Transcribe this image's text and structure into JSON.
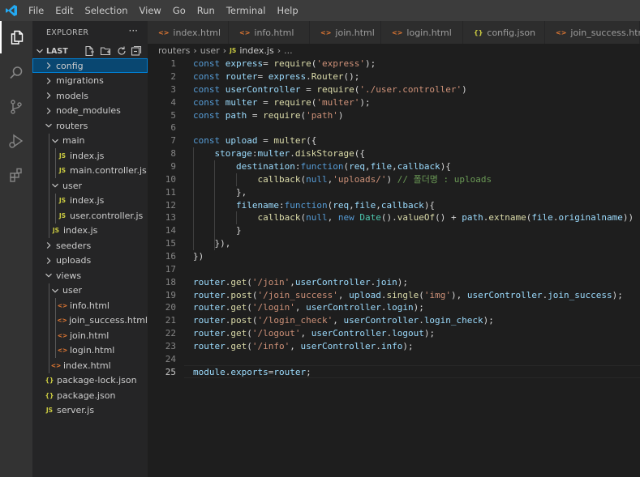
{
  "menu": [
    "File",
    "Edit",
    "Selection",
    "View",
    "Go",
    "Run",
    "Terminal",
    "Help"
  ],
  "explorer": {
    "title": "EXPLORER",
    "more": "···",
    "root": "LAST",
    "tree": [
      {
        "label": "config",
        "type": "folder",
        "open": false,
        "depth": 0,
        "selected": true
      },
      {
        "label": "migrations",
        "type": "folder",
        "open": false,
        "depth": 0
      },
      {
        "label": "models",
        "type": "folder",
        "open": false,
        "depth": 0
      },
      {
        "label": "node_modules",
        "type": "folder",
        "open": false,
        "depth": 0
      },
      {
        "label": "routers",
        "type": "folder",
        "open": true,
        "depth": 0
      },
      {
        "label": "main",
        "type": "folder",
        "open": true,
        "depth": 1
      },
      {
        "label": "index.js",
        "type": "js",
        "depth": 2
      },
      {
        "label": "main.controller.js",
        "type": "js",
        "depth": 2
      },
      {
        "label": "user",
        "type": "folder",
        "open": true,
        "depth": 1
      },
      {
        "label": "index.js",
        "type": "js",
        "depth": 2
      },
      {
        "label": "user.controller.js",
        "type": "js",
        "depth": 2
      },
      {
        "label": "index.js",
        "type": "js",
        "depth": 1
      },
      {
        "label": "seeders",
        "type": "folder",
        "open": false,
        "depth": 0
      },
      {
        "label": "uploads",
        "type": "folder",
        "open": false,
        "depth": 0
      },
      {
        "label": "views",
        "type": "folder",
        "open": true,
        "depth": 0
      },
      {
        "label": "user",
        "type": "folder",
        "open": true,
        "depth": 1
      },
      {
        "label": "info.html",
        "type": "html",
        "depth": 2
      },
      {
        "label": "join_success.html",
        "type": "html",
        "depth": 2
      },
      {
        "label": "join.html",
        "type": "html",
        "depth": 2
      },
      {
        "label": "login.html",
        "type": "html",
        "depth": 2
      },
      {
        "label": "index.html",
        "type": "html",
        "depth": 1
      },
      {
        "label": "package-lock.json",
        "type": "json",
        "depth": 0
      },
      {
        "label": "package.json",
        "type": "json",
        "depth": 0
      },
      {
        "label": "server.js",
        "type": "js",
        "depth": 0
      }
    ]
  },
  "tabs": [
    {
      "label": "index.html",
      "type": "html"
    },
    {
      "label": "info.html",
      "type": "html"
    },
    {
      "label": "join.html",
      "type": "html"
    },
    {
      "label": "login.html",
      "type": "html"
    },
    {
      "label": "config.json",
      "type": "json"
    },
    {
      "label": "join_success.html",
      "type": "html"
    }
  ],
  "breadcrumb": {
    "parts": [
      "routers",
      "user"
    ],
    "file": "index.js",
    "tail": "..."
  },
  "editor": {
    "current_line": 25,
    "lines": [
      [
        [
          "kw",
          "const "
        ],
        [
          "var",
          "express"
        ],
        [
          "",
          "= "
        ],
        [
          "fn",
          "require"
        ],
        [
          "",
          "("
        ],
        [
          "str",
          "'express'"
        ],
        [
          "",
          ");"
        ]
      ],
      [
        [
          "kw",
          "const "
        ],
        [
          "var",
          "router"
        ],
        [
          "",
          "= "
        ],
        [
          "var",
          "express"
        ],
        [
          "",
          "."
        ],
        [
          "fn",
          "Router"
        ],
        [
          "",
          "();"
        ]
      ],
      [
        [
          "kw",
          "const "
        ],
        [
          "var",
          "userController"
        ],
        [
          "",
          " = "
        ],
        [
          "fn",
          "require"
        ],
        [
          "",
          "("
        ],
        [
          "str",
          "'./user.controller'"
        ],
        [
          "",
          ")"
        ]
      ],
      [
        [
          "kw",
          "const "
        ],
        [
          "var",
          "multer"
        ],
        [
          "",
          " = "
        ],
        [
          "fn",
          "require"
        ],
        [
          "",
          "("
        ],
        [
          "str",
          "'multer'"
        ],
        [
          "",
          ");"
        ]
      ],
      [
        [
          "kw",
          "const "
        ],
        [
          "var",
          "path"
        ],
        [
          "",
          " = "
        ],
        [
          "fn",
          "require"
        ],
        [
          "",
          "("
        ],
        [
          "str",
          "'path'"
        ],
        [
          "",
          ")"
        ]
      ],
      [],
      [
        [
          "kw",
          "const "
        ],
        [
          "var",
          "upload"
        ],
        [
          "",
          " = "
        ],
        [
          "fn",
          "multer"
        ],
        [
          "",
          "({"
        ]
      ],
      [
        [
          "",
          "    "
        ],
        [
          "var",
          "storage"
        ],
        [
          "",
          ":"
        ],
        [
          "var",
          "multer"
        ],
        [
          "",
          "."
        ],
        [
          "fn",
          "diskStorage"
        ],
        [
          "",
          "({"
        ]
      ],
      [
        [
          "",
          "        "
        ],
        [
          "var",
          "destination"
        ],
        [
          "",
          ":"
        ],
        [
          "kw",
          "function"
        ],
        [
          "",
          "("
        ],
        [
          "var",
          "req"
        ],
        [
          "",
          ","
        ],
        [
          "var",
          "file"
        ],
        [
          "",
          ","
        ],
        [
          "var",
          "callback"
        ],
        [
          "",
          "){"
        ]
      ],
      [
        [
          "",
          "            "
        ],
        [
          "fn",
          "callback"
        ],
        [
          "",
          "("
        ],
        [
          "kw",
          "null"
        ],
        [
          "",
          ","
        ],
        [
          "str",
          "'uploads/'"
        ],
        [
          "",
          ") "
        ],
        [
          "cmt",
          "// 폴더명 : uploads"
        ]
      ],
      [
        [
          "",
          "        },"
        ]
      ],
      [
        [
          "",
          "        "
        ],
        [
          "var",
          "filename"
        ],
        [
          "",
          ":"
        ],
        [
          "kw",
          "function"
        ],
        [
          "",
          "("
        ],
        [
          "var",
          "req"
        ],
        [
          "",
          ","
        ],
        [
          "var",
          "file"
        ],
        [
          "",
          ","
        ],
        [
          "var",
          "callback"
        ],
        [
          "",
          "){"
        ]
      ],
      [
        [
          "",
          "            "
        ],
        [
          "fn",
          "callback"
        ],
        [
          "",
          "("
        ],
        [
          "kw",
          "null"
        ],
        [
          "",
          ", "
        ],
        [
          "kw",
          "new "
        ],
        [
          "cls",
          "Date"
        ],
        [
          "",
          "()."
        ],
        [
          "fn",
          "valueOf"
        ],
        [
          "",
          "() + "
        ],
        [
          "var",
          "path"
        ],
        [
          "",
          "."
        ],
        [
          "fn",
          "extname"
        ],
        [
          "",
          "("
        ],
        [
          "var",
          "file"
        ],
        [
          "",
          "."
        ],
        [
          "var",
          "originalname"
        ],
        [
          "",
          "))"
        ]
      ],
      [
        [
          "",
          "        }"
        ]
      ],
      [
        [
          "",
          "    }),"
        ]
      ],
      [
        [
          "",
          "})"
        ]
      ],
      [],
      [
        [
          "var",
          "router"
        ],
        [
          "",
          "."
        ],
        [
          "fn",
          "get"
        ],
        [
          "",
          "("
        ],
        [
          "str",
          "'/join'"
        ],
        [
          "",
          ","
        ],
        [
          "var",
          "userController"
        ],
        [
          "",
          "."
        ],
        [
          "var",
          "join"
        ],
        [
          "",
          ");"
        ]
      ],
      [
        [
          "var",
          "router"
        ],
        [
          "",
          "."
        ],
        [
          "fn",
          "post"
        ],
        [
          "",
          "("
        ],
        [
          "str",
          "'/join_success'"
        ],
        [
          "",
          ", "
        ],
        [
          "var",
          "upload"
        ],
        [
          "",
          "."
        ],
        [
          "fn",
          "single"
        ],
        [
          "",
          "("
        ],
        [
          "str",
          "'img'"
        ],
        [
          "",
          "), "
        ],
        [
          "var",
          "userController"
        ],
        [
          "",
          "."
        ],
        [
          "var",
          "join_success"
        ],
        [
          "",
          ");"
        ]
      ],
      [
        [
          "var",
          "router"
        ],
        [
          "",
          "."
        ],
        [
          "fn",
          "get"
        ],
        [
          "",
          "("
        ],
        [
          "str",
          "'/login'"
        ],
        [
          "",
          ", "
        ],
        [
          "var",
          "userController"
        ],
        [
          "",
          "."
        ],
        [
          "var",
          "login"
        ],
        [
          "",
          ");"
        ]
      ],
      [
        [
          "var",
          "router"
        ],
        [
          "",
          "."
        ],
        [
          "fn",
          "post"
        ],
        [
          "",
          "("
        ],
        [
          "str",
          "'/login_check'"
        ],
        [
          "",
          ", "
        ],
        [
          "var",
          "userController"
        ],
        [
          "",
          "."
        ],
        [
          "var",
          "login_check"
        ],
        [
          "",
          ");"
        ]
      ],
      [
        [
          "var",
          "router"
        ],
        [
          "",
          "."
        ],
        [
          "fn",
          "get"
        ],
        [
          "",
          "("
        ],
        [
          "str",
          "'/logout'"
        ],
        [
          "",
          ", "
        ],
        [
          "var",
          "userController"
        ],
        [
          "",
          "."
        ],
        [
          "var",
          "logout"
        ],
        [
          "",
          ");"
        ]
      ],
      [
        [
          "var",
          "router"
        ],
        [
          "",
          "."
        ],
        [
          "fn",
          "get"
        ],
        [
          "",
          "("
        ],
        [
          "str",
          "'/info'"
        ],
        [
          "",
          ", "
        ],
        [
          "var",
          "userController"
        ],
        [
          "",
          "."
        ],
        [
          "var",
          "info"
        ],
        [
          "",
          ");"
        ]
      ],
      [],
      [
        [
          "var",
          "module"
        ],
        [
          "",
          "."
        ],
        [
          "var",
          "exports"
        ],
        [
          "",
          "="
        ],
        [
          "var",
          "router"
        ],
        [
          "",
          ";"
        ]
      ]
    ]
  },
  "colors": {
    "accent": "#007acc",
    "js_icon": "#cbcb41",
    "html_icon": "#e37933",
    "json_icon": "#cbcb41",
    "folder_chevron": "#c5c5c5"
  }
}
